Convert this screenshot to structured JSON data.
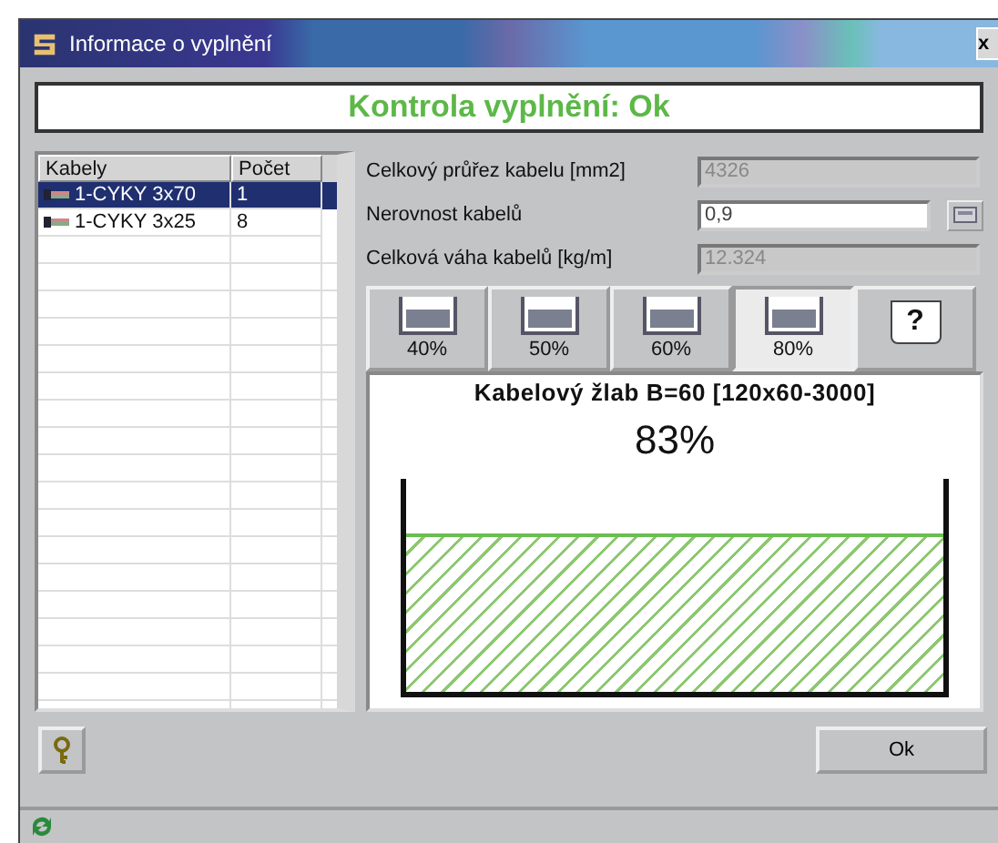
{
  "window": {
    "title": "Informace o vyplnění",
    "close": "x"
  },
  "status_message": "Kontrola vyplnění: Ok",
  "table": {
    "columns": [
      "Kabely",
      "Počet"
    ],
    "rows": [
      {
        "name": "1-CYKY 3x70",
        "count": "1",
        "selected": true
      },
      {
        "name": "1-CYKY 3x25",
        "count": "8",
        "selected": false
      }
    ]
  },
  "fields": [
    {
      "label": "Celkový průřez kabelu [mm2]",
      "value": "4326",
      "disabled": true,
      "kind": "plain"
    },
    {
      "label": "Nerovnost kabelů",
      "value": "0,9",
      "disabled": false,
      "kind": "with_button"
    },
    {
      "label": "Celková váha kabelů [kg/m]",
      "value": "12.324",
      "disabled": true,
      "kind": "plain"
    }
  ],
  "fill_buttons": [
    {
      "label": "40%",
      "kind": "fill",
      "selected": false
    },
    {
      "label": "50%",
      "kind": "fill",
      "selected": false
    },
    {
      "label": "60%",
      "kind": "fill",
      "selected": false
    },
    {
      "label": "80%",
      "kind": "fill",
      "selected": true
    },
    {
      "label": "?",
      "kind": "help",
      "selected": false
    }
  ],
  "tray": {
    "title": "Kabelový žlab B=60 [120x60-3000]",
    "percent": "83%"
  },
  "ok_button": "Ok"
}
